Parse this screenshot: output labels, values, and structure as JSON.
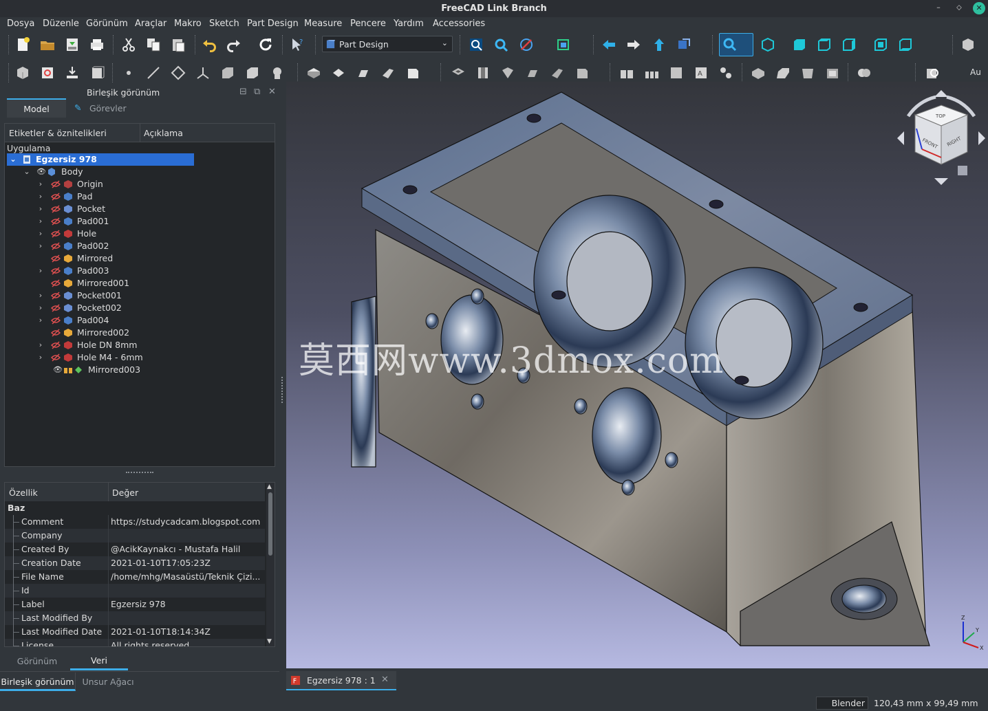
{
  "window": {
    "title": "FreeCAD Link Branch"
  },
  "menu": [
    "Dosya",
    "Düzenle",
    "Görünüm",
    "Araçlar",
    "Makro",
    "Sketch",
    "Part Design",
    "Measure",
    "Pencere",
    "Yardım",
    "Accessories"
  ],
  "workbench": {
    "selected": "Part Design"
  },
  "toolbar2_overflow_label": "Au",
  "left_panel": {
    "title": "Birleşik görünüm",
    "tabs": [
      "Model",
      "Görevler"
    ],
    "tree_columns": [
      "Etiketler & öznitelikleri",
      "Açıklama"
    ],
    "tree_section": "Uygulama",
    "document": "Egzersiz 978",
    "body": "Body",
    "features": [
      "Origin",
      "Pad",
      "Pocket",
      "Pad001",
      "Hole",
      "Pad002",
      "Mirrored",
      "Pad003",
      "Mirrored001",
      "Pocket001",
      "Pocket002",
      "Pad004",
      "Mirrored002",
      "Hole DN 8mm",
      "Hole M4 - 6mm",
      "Mirrored003"
    ]
  },
  "properties": {
    "columns": [
      "Özellik",
      "Değer"
    ],
    "group": "Baz",
    "rows": [
      {
        "key": "Comment",
        "value": "https://studycadcam.blogspot.com"
      },
      {
        "key": "Company",
        "value": ""
      },
      {
        "key": "Created By",
        "value": "@AcikKaynakcı - Mustafa Halil"
      },
      {
        "key": "Creation Date",
        "value": "2021-01-10T17:05:23Z"
      },
      {
        "key": "File Name",
        "value": "/home/mhg/Masaüstü/Teknik Çizi..."
      },
      {
        "key": "Id",
        "value": ""
      },
      {
        "key": "Label",
        "value": "Egzersiz 978"
      },
      {
        "key": "Last Modified By",
        "value": ""
      },
      {
        "key": "Last Modified Date",
        "value": "2021-01-10T18:14:34Z"
      },
      {
        "key": "License",
        "value": "All rights reserved"
      }
    ],
    "tabs": [
      "Görünüm",
      "Veri"
    ]
  },
  "bottom_tabs": [
    "Birleşik görünüm",
    "Unsur Ağacı"
  ],
  "document_tab": {
    "label": "Egzersiz 978 : 1"
  },
  "viewport": {
    "watermark": "莫西网www.3dmox.com"
  },
  "navcube": {
    "faces": [
      "TOP",
      "FRONT",
      "RIGHT"
    ]
  },
  "axes": [
    "Z",
    "Y",
    "X"
  ],
  "status": {
    "navigation_style": "Blender",
    "dimensions": "120,43 mm x 99,49 mm"
  }
}
